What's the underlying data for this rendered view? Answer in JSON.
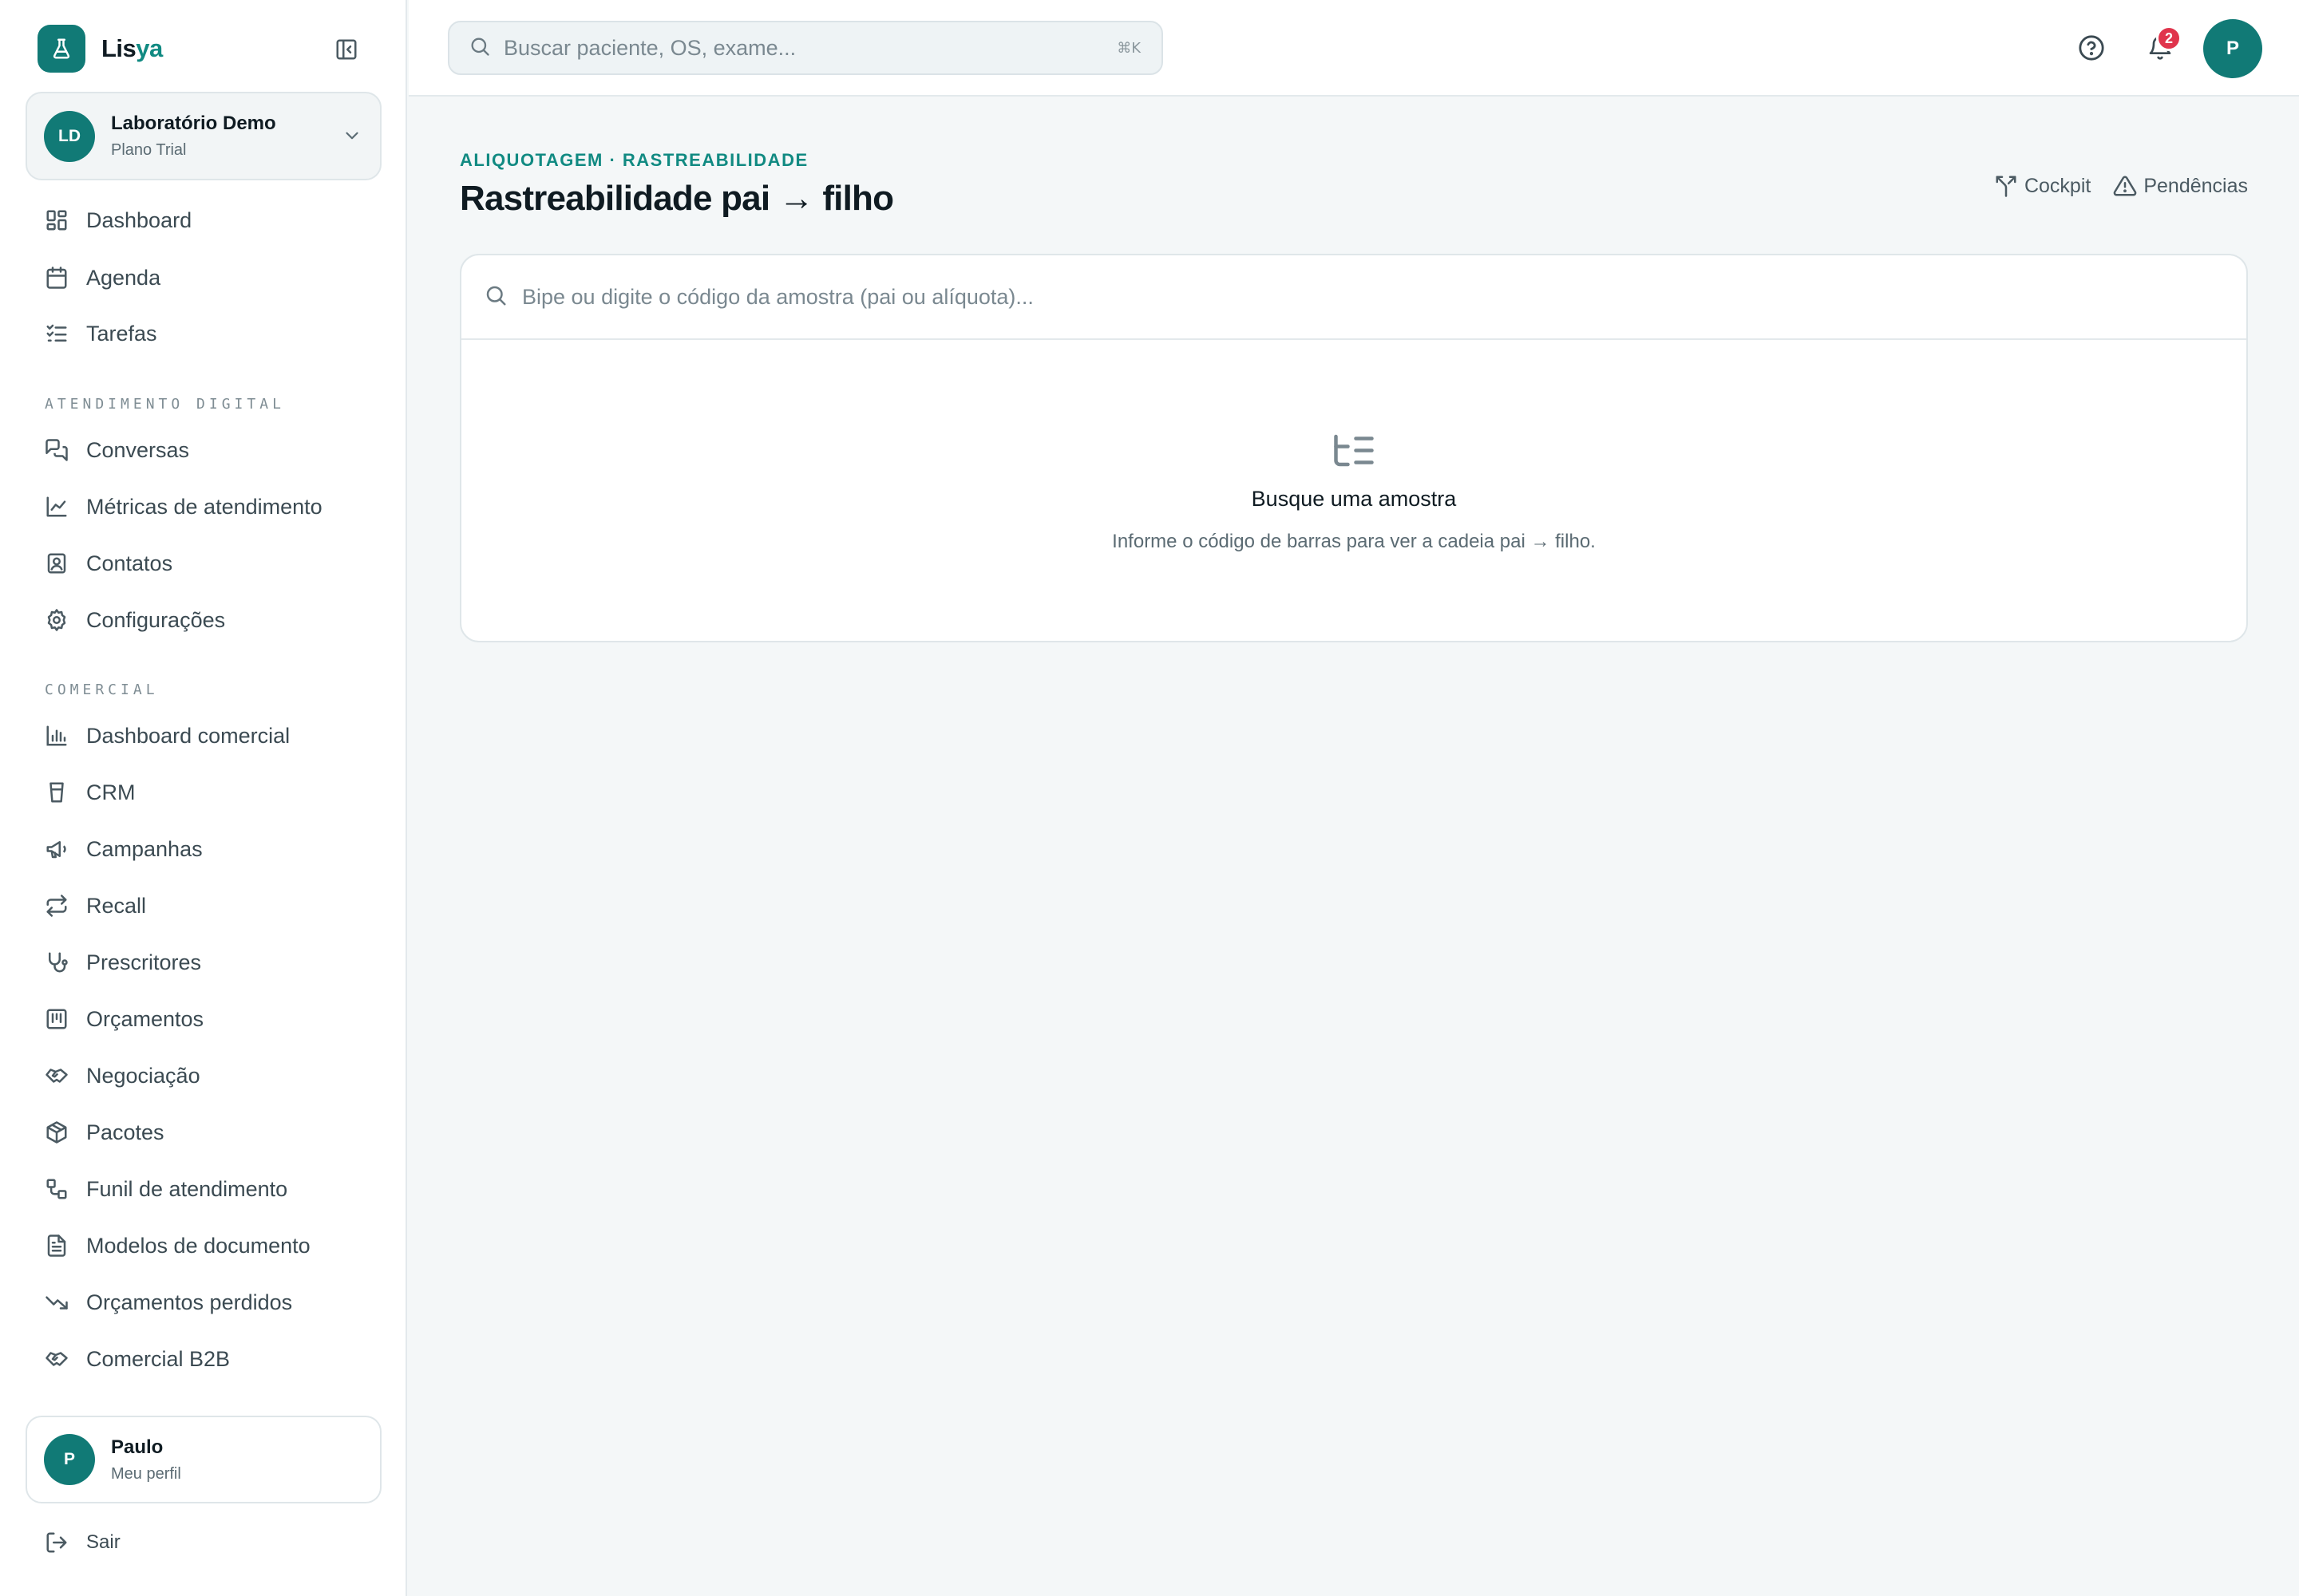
{
  "brand": {
    "name_part1": "Lis",
    "name_part2": "ya"
  },
  "org": {
    "initials": "LD",
    "name": "Laboratório Demo",
    "plan": "Plano Trial"
  },
  "nav_main": [
    {
      "label": "Dashboard",
      "icon": "dashboard-icon"
    },
    {
      "label": "Agenda",
      "icon": "calendar-icon"
    },
    {
      "label": "Tarefas",
      "icon": "tasks-icon"
    }
  ],
  "section_digital": "ATENDIMENTO DIGITAL",
  "nav_digital": [
    {
      "label": "Conversas",
      "icon": "chat-icon"
    },
    {
      "label": "Métricas de atendimento",
      "icon": "line-chart-icon"
    },
    {
      "label": "Contatos",
      "icon": "contact-icon"
    },
    {
      "label": "Configurações",
      "icon": "gear-icon"
    }
  ],
  "section_comercial": "COMERCIAL",
  "nav_comercial": [
    {
      "label": "Dashboard comercial",
      "icon": "bar-chart-icon"
    },
    {
      "label": "CRM",
      "icon": "cup-icon"
    },
    {
      "label": "Campanhas",
      "icon": "megaphone-icon"
    },
    {
      "label": "Recall",
      "icon": "repeat-icon"
    },
    {
      "label": "Prescritores",
      "icon": "stethoscope-icon"
    },
    {
      "label": "Orçamentos",
      "icon": "receipt-icon"
    },
    {
      "label": "Negociação",
      "icon": "handshake-icon"
    },
    {
      "label": "Pacotes",
      "icon": "package-icon"
    },
    {
      "label": "Funil de atendimento",
      "icon": "workflow-icon"
    },
    {
      "label": "Modelos de documento",
      "icon": "document-icon"
    },
    {
      "label": "Orçamentos perdidos",
      "icon": "trending-down-icon"
    },
    {
      "label": "Comercial B2B",
      "icon": "handshake-icon"
    }
  ],
  "user": {
    "initial": "P",
    "name": "Paulo",
    "subtitle": "Meu perfil"
  },
  "logout_label": "Sair",
  "topbar": {
    "search_placeholder": "Buscar paciente, OS, exame...",
    "shortcut": "⌘K",
    "notification_count": "2",
    "avatar_initial": "P"
  },
  "page": {
    "eyebrow": "ALIQUOTAGEM · RASTREABILIDADE",
    "title": "Rastreabilidade pai → filho",
    "links": {
      "cockpit": "Cockpit",
      "pendencias": "Pendências"
    },
    "sample_search_placeholder": "Bipe ou digite o código da amostra (pai ou alíquota)...",
    "empty_title": "Busque uma amostra",
    "empty_subtitle": "Informe o código de barras para ver a cadeia pai → filho."
  },
  "colors": {
    "brand": "#117a76",
    "accent": "#118a82",
    "badge": "#e0344c"
  }
}
